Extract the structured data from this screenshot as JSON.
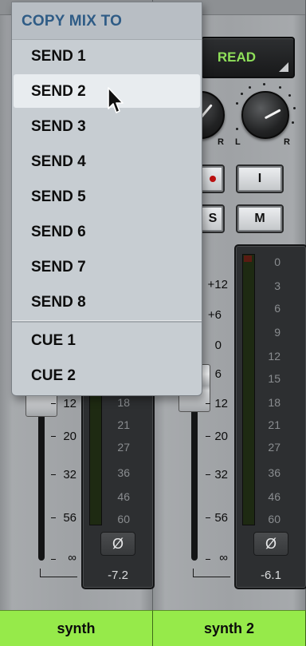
{
  "menu": {
    "title": "COPY MIX TO",
    "items": [
      {
        "label": "SEND 1"
      },
      {
        "label": "SEND 2",
        "highlighted": true
      },
      {
        "label": "SEND 3"
      },
      {
        "label": "SEND 4"
      },
      {
        "label": "SEND 5"
      },
      {
        "label": "SEND 6"
      },
      {
        "label": "SEND 7"
      },
      {
        "label": "SEND 8"
      }
    ],
    "cue_items": [
      {
        "label": "CUE 1"
      },
      {
        "label": "CUE 2"
      }
    ]
  },
  "channels": [
    {
      "name": "synth",
      "fader_scale": [
        "12",
        "20",
        "32",
        "56",
        "∞"
      ],
      "meter_scale": [
        "18",
        "21",
        "27",
        "36",
        "46",
        "60"
      ],
      "phase_symbol": "Ø",
      "level": "-7.2",
      "pan_labels": {
        "right": "R"
      }
    },
    {
      "name": "synth 2",
      "automation_mode": "READ",
      "fader_scale_top": [
        "+12",
        "+6",
        "0",
        "6"
      ],
      "fader_scale": [
        "12",
        "20",
        "32",
        "56",
        "∞"
      ],
      "meter_scale": [
        "0",
        "3",
        "6",
        "9",
        "12",
        "15",
        "18",
        "21",
        "27",
        "36",
        "46",
        "60"
      ],
      "phase_symbol": "Ø",
      "level": "-6.1",
      "pan_labels": {
        "left": "L",
        "right": "R"
      },
      "buttons": {
        "input": "I",
        "mute": "M"
      }
    }
  ],
  "colors": {
    "name_tab": "#96ea4a",
    "automation_text": "#8fe05a",
    "menu_title": "#2f5c86"
  }
}
